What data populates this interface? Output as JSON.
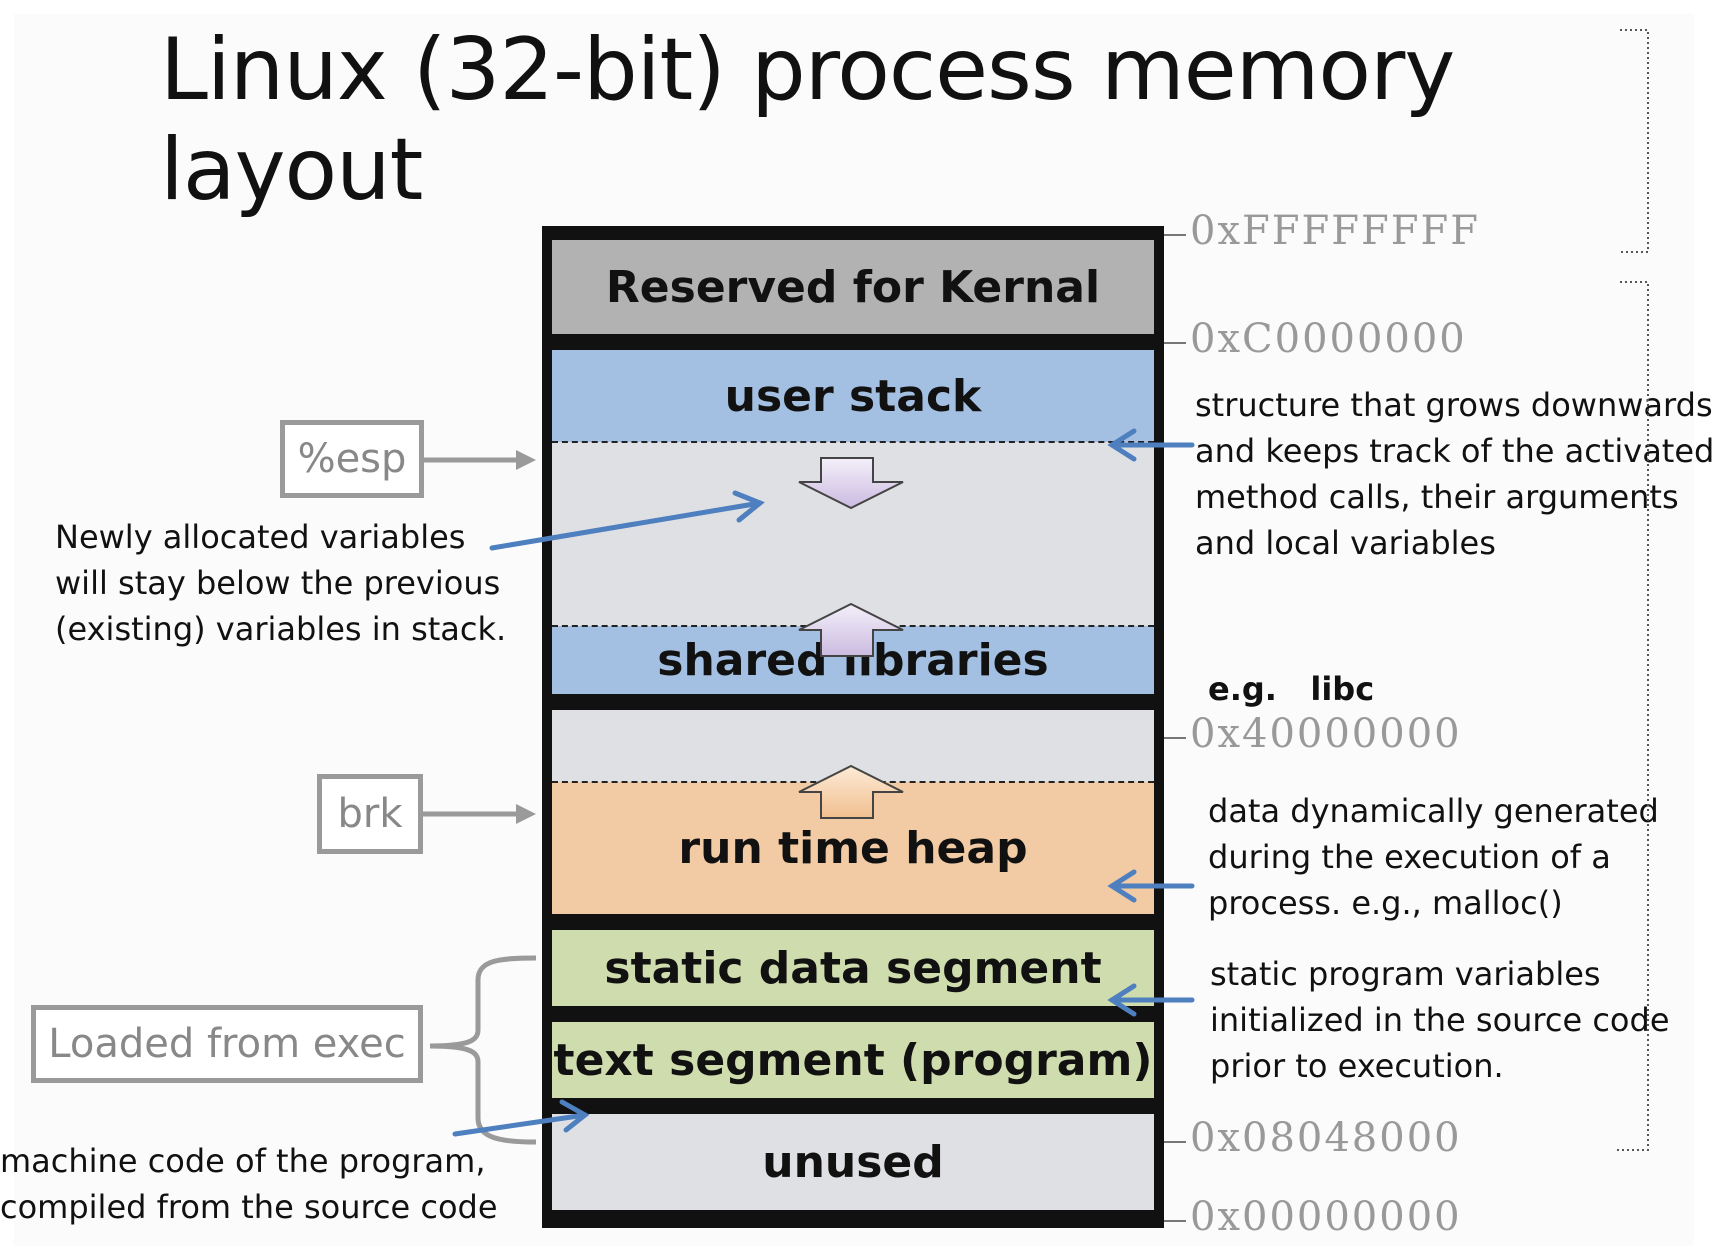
{
  "title": "Linux (32-bit) process memory layout",
  "segments": {
    "kernel": "Reserved for Kernal",
    "stack": "user stack",
    "shared": "shared libraries",
    "heap": "run time heap",
    "static": "static data segment",
    "text": "text segment (program)",
    "unused": "unused"
  },
  "addresses": {
    "top": "0xFFFFFFFF",
    "kernel_base": "0xC0000000",
    "libs": "0x40000000",
    "text_base": "0x08048000",
    "zero": "0x00000000"
  },
  "pointers": {
    "esp": "%esp",
    "brk": "brk",
    "exec": "Loaded from exec"
  },
  "notes": {
    "stack_desc": [
      "structure that grows downwards",
      "and  keeps track  of the activated",
      "method calls, their arguments",
      "and local variables"
    ],
    "newly": [
      "Newly allocated variables",
      "will stay below the previous",
      "(existing) variables in stack."
    ],
    "libc": "e.g.   libc",
    "heap_desc": [
      "data dynamically generated",
      "during the execution of a",
      "process. e.g.,  malloc()"
    ],
    "static_desc": [
      "static program variables",
      "initialized in the source code",
      "prior to execution."
    ],
    "machine": [
      "machine code of the program,",
      "compiled from the source code"
    ]
  },
  "colors": {
    "kernel": "#b2b2b2",
    "stack": "#a3bfe1",
    "gap": "#dfe0e3",
    "heap": "#f2cba5",
    "data": "#cfdcad",
    "arrow_blue": "#4e7fbf",
    "arrow_gray": "#9a9a9a"
  }
}
